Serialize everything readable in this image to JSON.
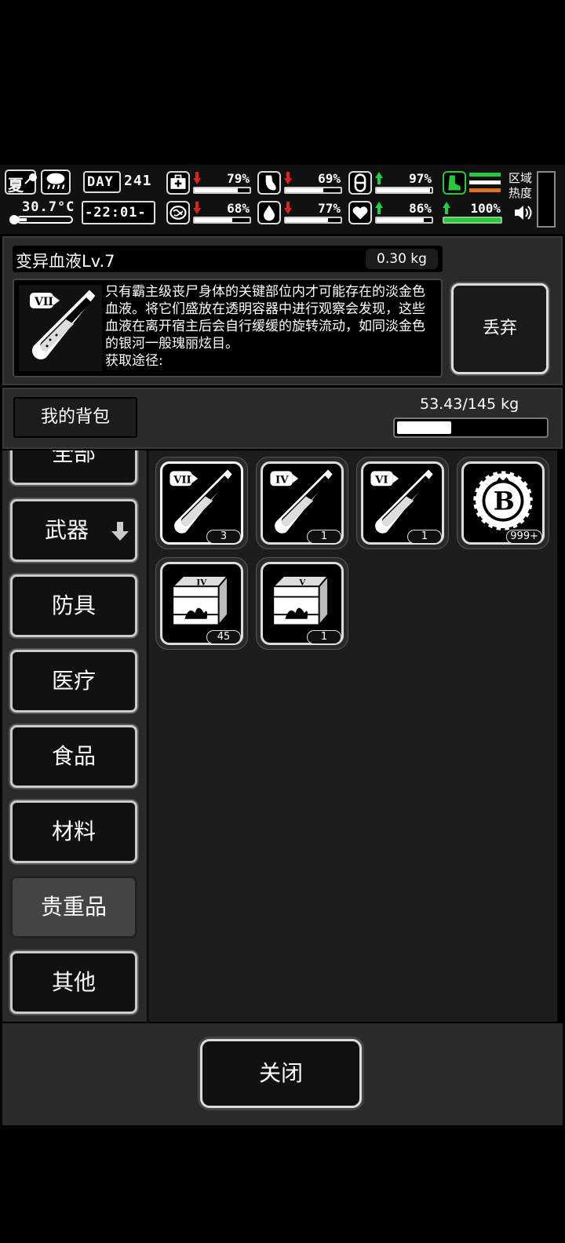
{
  "status": {
    "season": "夏",
    "temperature": "30.7°C",
    "day_label": "DAY",
    "day_number": "241",
    "clock": "-22:01-",
    "region_heat_label": "区域\n热度",
    "stats": [
      {
        "name": "health",
        "icon": "medkit-icon",
        "trend": "down",
        "value": "79%",
        "level": 0.79
      },
      {
        "name": "hunger",
        "icon": "stomach-icon",
        "trend": "down",
        "value": "69%",
        "level": 0.69
      },
      {
        "name": "drug",
        "icon": "pill-icon",
        "trend": "up",
        "value": "97%",
        "level": 0.97
      },
      {
        "name": "sanity",
        "icon": "brain-icon",
        "trend": "down",
        "value": "68%",
        "level": 0.68
      },
      {
        "name": "thirst",
        "icon": "water-drop-icon",
        "trend": "down",
        "value": "77%",
        "level": 0.77
      },
      {
        "name": "mood",
        "icon": "heart-icon",
        "trend": "up",
        "value": "86%",
        "level": 0.86
      },
      {
        "name": "stamina",
        "icon": "boot-icon",
        "trend": "up",
        "value": "100%",
        "level": 1.0
      }
    ],
    "colors": {
      "down_arrow": "#e02020",
      "up_arrow": "#20d040",
      "stamina_bar": "#28c83c"
    }
  },
  "item": {
    "name": "变异血液Lv.7",
    "weight": "0.30 kg",
    "description": "只有霸主级丧尸身体的关键部位内才可能存在的淡金色血液。将它们盛放在透明容器中进行观察会发现，这些血液在离开宿主后会自行缓缓的旋转流动，如同淡金色的银河一般瑰丽炫目。",
    "source_label": "获取途径:",
    "drop_label": "丢弃"
  },
  "bag": {
    "tab_label": "我的背包",
    "capacity": "53.43/145 kg",
    "capacity_fraction": 0.368
  },
  "categories": [
    "全部",
    "武器",
    "防具",
    "医疗",
    "食品",
    "材料",
    "贵重品",
    "其他"
  ],
  "active_category": "贵重品",
  "items": [
    {
      "name": "mutant-blood-vii",
      "tier": "VII",
      "count": "3",
      "selected": true
    },
    {
      "name": "mutant-blood-iv",
      "tier": "IV",
      "count": "1"
    },
    {
      "name": "mutant-blood-vi",
      "tier": "VI",
      "count": "1"
    },
    {
      "name": "b-coin",
      "tier": "B",
      "count": "999+"
    },
    {
      "name": "supply-crate-iv",
      "tier": "IV",
      "count": "45"
    },
    {
      "name": "supply-crate-v",
      "tier": "V",
      "count": "1"
    }
  ],
  "close_label": "关闭"
}
